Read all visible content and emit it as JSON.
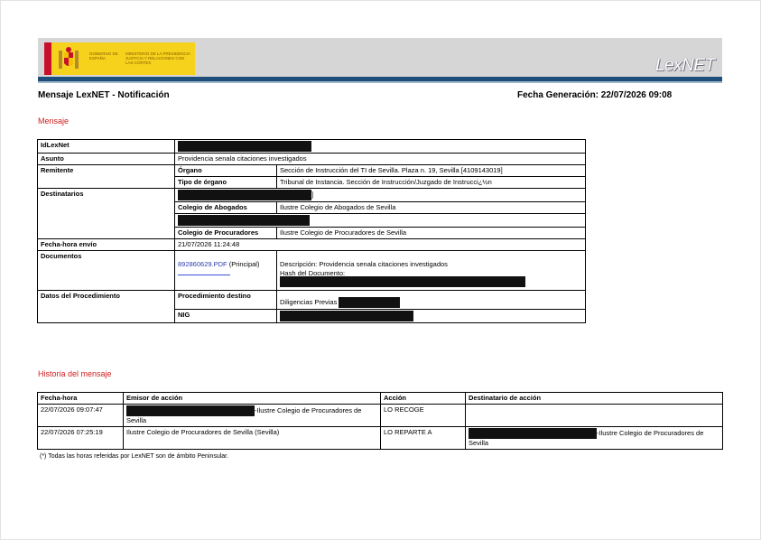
{
  "header": {
    "gov_text_1": "GOBIERNO DE ESPAÑA",
    "gov_text_2": "MINISTERIO DE LA PRESIDENCIA JUSTICIA Y RELACIONES CON LAS CORTES",
    "lexnet_logo": "LexNET"
  },
  "title": "Mensaje LexNET - Notificación",
  "generation_date": "Fecha Generación: 22/07/2026 09:08",
  "mensaje": {
    "section_label": "Mensaje",
    "idlexnet_label": "IdLexNet",
    "asunto_label": "Asunto",
    "asunto_value": "Providencia senala citaciones investigados",
    "remitente_label": "Remitente",
    "organo_label": "Órgano",
    "organo_value": "Sección de Instrucción del TI  de Sevilla. Plaza n. 19, Sevilla [4109143019]",
    "tipo_organo_label": "Tipo de órgano",
    "tipo_organo_value": "Tribunal de Instancia. Sección de Instrucción/Juzgado de Instrucci¿½n",
    "destinatarios_label": "Destinatarios",
    "bracket_suffix": "]",
    "colegio_abogados_label": "Colegio de Abogados",
    "colegio_abogados_value": "Ilustre Colegio de Abogados de Sevilla",
    "colegio_procuradores_label": "Colegio de Procuradores",
    "colegio_procuradores_value": "Ilustre Colegio de Procuradores de Sevilla",
    "fecha_envio_label": "Fecha-hora envío",
    "fecha_envio_value": "21/07/2026 11:24:48",
    "documentos_label": "Documentos",
    "documento_link": "892860629.PDF",
    "documento_tag": " (Principal)",
    "descripcion": "Descripción: Providencia senala citaciones investigados",
    "hash_label": "Hash del Documento:",
    "datos_label": "Datos del Procedimiento",
    "procedimiento_destino_label": "Procedimiento destino",
    "procedimiento_destino_value": "Diligencias Previas",
    "nig_label": "NIG"
  },
  "historia": {
    "section_label": "Historia del mensaje",
    "headers": [
      "Fecha-hora",
      "Emisor de acción",
      "Acción",
      "Destinatario de acción"
    ],
    "rows": [
      {
        "fecha": "22/07/2026 09:07:47",
        "emisor": "-Ilustre Colegio de Procuradores de Sevilla",
        "accion": "LO RECOGE",
        "destinatario": ""
      },
      {
        "fecha": "22/07/2026 07:25:19",
        "emisor": "Ilustre Colegio de Procuradores de Sevilla (Sevilla)",
        "accion": "LO REPARTE A",
        "destinatario": "-Ilustre Colegio de Procuradores de Sevilla"
      }
    ]
  },
  "footnote": "(*) Todas las horas referidas por LexNET son de ámbito Peninsular."
}
